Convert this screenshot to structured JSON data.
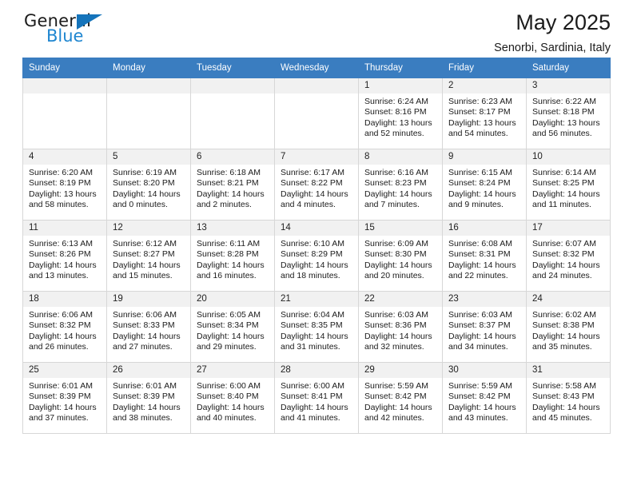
{
  "brand": {
    "name_top": "General",
    "name_bottom": "Blue",
    "flag_icon": "blue-triangle-flag",
    "color_dark": "#1b1b1b",
    "color_blue": "#1f86d0"
  },
  "header": {
    "title": "May 2025",
    "subtitle": "Senorbi, Sardinia, Italy"
  },
  "theme": {
    "header_row_bg": "#3a7dc0",
    "header_row_text": "#ffffff",
    "daynum_bg": "#f1f1f1",
    "cell_border": "#d7d7d7"
  },
  "weekdays": [
    "Sunday",
    "Monday",
    "Tuesday",
    "Wednesday",
    "Thursday",
    "Friday",
    "Saturday"
  ],
  "labels": {
    "sunrise": "Sunrise:",
    "sunset": "Sunset:",
    "daylight": "Daylight:"
  },
  "weeks": [
    [
      {
        "day": ""
      },
      {
        "day": ""
      },
      {
        "day": ""
      },
      {
        "day": ""
      },
      {
        "day": "1",
        "sunrise": "Sunrise: 6:24 AM",
        "sunset": "Sunset: 8:16 PM",
        "daylight_1": "Daylight: 13 hours",
        "daylight_2": "and 52 minutes."
      },
      {
        "day": "2",
        "sunrise": "Sunrise: 6:23 AM",
        "sunset": "Sunset: 8:17 PM",
        "daylight_1": "Daylight: 13 hours",
        "daylight_2": "and 54 minutes."
      },
      {
        "day": "3",
        "sunrise": "Sunrise: 6:22 AM",
        "sunset": "Sunset: 8:18 PM",
        "daylight_1": "Daylight: 13 hours",
        "daylight_2": "and 56 minutes."
      }
    ],
    [
      {
        "day": "4",
        "sunrise": "Sunrise: 6:20 AM",
        "sunset": "Sunset: 8:19 PM",
        "daylight_1": "Daylight: 13 hours",
        "daylight_2": "and 58 minutes."
      },
      {
        "day": "5",
        "sunrise": "Sunrise: 6:19 AM",
        "sunset": "Sunset: 8:20 PM",
        "daylight_1": "Daylight: 14 hours",
        "daylight_2": "and 0 minutes."
      },
      {
        "day": "6",
        "sunrise": "Sunrise: 6:18 AM",
        "sunset": "Sunset: 8:21 PM",
        "daylight_1": "Daylight: 14 hours",
        "daylight_2": "and 2 minutes."
      },
      {
        "day": "7",
        "sunrise": "Sunrise: 6:17 AM",
        "sunset": "Sunset: 8:22 PM",
        "daylight_1": "Daylight: 14 hours",
        "daylight_2": "and 4 minutes."
      },
      {
        "day": "8",
        "sunrise": "Sunrise: 6:16 AM",
        "sunset": "Sunset: 8:23 PM",
        "daylight_1": "Daylight: 14 hours",
        "daylight_2": "and 7 minutes."
      },
      {
        "day": "9",
        "sunrise": "Sunrise: 6:15 AM",
        "sunset": "Sunset: 8:24 PM",
        "daylight_1": "Daylight: 14 hours",
        "daylight_2": "and 9 minutes."
      },
      {
        "day": "10",
        "sunrise": "Sunrise: 6:14 AM",
        "sunset": "Sunset: 8:25 PM",
        "daylight_1": "Daylight: 14 hours",
        "daylight_2": "and 11 minutes."
      }
    ],
    [
      {
        "day": "11",
        "sunrise": "Sunrise: 6:13 AM",
        "sunset": "Sunset: 8:26 PM",
        "daylight_1": "Daylight: 14 hours",
        "daylight_2": "and 13 minutes."
      },
      {
        "day": "12",
        "sunrise": "Sunrise: 6:12 AM",
        "sunset": "Sunset: 8:27 PM",
        "daylight_1": "Daylight: 14 hours",
        "daylight_2": "and 15 minutes."
      },
      {
        "day": "13",
        "sunrise": "Sunrise: 6:11 AM",
        "sunset": "Sunset: 8:28 PM",
        "daylight_1": "Daylight: 14 hours",
        "daylight_2": "and 16 minutes."
      },
      {
        "day": "14",
        "sunrise": "Sunrise: 6:10 AM",
        "sunset": "Sunset: 8:29 PM",
        "daylight_1": "Daylight: 14 hours",
        "daylight_2": "and 18 minutes."
      },
      {
        "day": "15",
        "sunrise": "Sunrise: 6:09 AM",
        "sunset": "Sunset: 8:30 PM",
        "daylight_1": "Daylight: 14 hours",
        "daylight_2": "and 20 minutes."
      },
      {
        "day": "16",
        "sunrise": "Sunrise: 6:08 AM",
        "sunset": "Sunset: 8:31 PM",
        "daylight_1": "Daylight: 14 hours",
        "daylight_2": "and 22 minutes."
      },
      {
        "day": "17",
        "sunrise": "Sunrise: 6:07 AM",
        "sunset": "Sunset: 8:32 PM",
        "daylight_1": "Daylight: 14 hours",
        "daylight_2": "and 24 minutes."
      }
    ],
    [
      {
        "day": "18",
        "sunrise": "Sunrise: 6:06 AM",
        "sunset": "Sunset: 8:32 PM",
        "daylight_1": "Daylight: 14 hours",
        "daylight_2": "and 26 minutes."
      },
      {
        "day": "19",
        "sunrise": "Sunrise: 6:06 AM",
        "sunset": "Sunset: 8:33 PM",
        "daylight_1": "Daylight: 14 hours",
        "daylight_2": "and 27 minutes."
      },
      {
        "day": "20",
        "sunrise": "Sunrise: 6:05 AM",
        "sunset": "Sunset: 8:34 PM",
        "daylight_1": "Daylight: 14 hours",
        "daylight_2": "and 29 minutes."
      },
      {
        "day": "21",
        "sunrise": "Sunrise: 6:04 AM",
        "sunset": "Sunset: 8:35 PM",
        "daylight_1": "Daylight: 14 hours",
        "daylight_2": "and 31 minutes."
      },
      {
        "day": "22",
        "sunrise": "Sunrise: 6:03 AM",
        "sunset": "Sunset: 8:36 PM",
        "daylight_1": "Daylight: 14 hours",
        "daylight_2": "and 32 minutes."
      },
      {
        "day": "23",
        "sunrise": "Sunrise: 6:03 AM",
        "sunset": "Sunset: 8:37 PM",
        "daylight_1": "Daylight: 14 hours",
        "daylight_2": "and 34 minutes."
      },
      {
        "day": "24",
        "sunrise": "Sunrise: 6:02 AM",
        "sunset": "Sunset: 8:38 PM",
        "daylight_1": "Daylight: 14 hours",
        "daylight_2": "and 35 minutes."
      }
    ],
    [
      {
        "day": "25",
        "sunrise": "Sunrise: 6:01 AM",
        "sunset": "Sunset: 8:39 PM",
        "daylight_1": "Daylight: 14 hours",
        "daylight_2": "and 37 minutes."
      },
      {
        "day": "26",
        "sunrise": "Sunrise: 6:01 AM",
        "sunset": "Sunset: 8:39 PM",
        "daylight_1": "Daylight: 14 hours",
        "daylight_2": "and 38 minutes."
      },
      {
        "day": "27",
        "sunrise": "Sunrise: 6:00 AM",
        "sunset": "Sunset: 8:40 PM",
        "daylight_1": "Daylight: 14 hours",
        "daylight_2": "and 40 minutes."
      },
      {
        "day": "28",
        "sunrise": "Sunrise: 6:00 AM",
        "sunset": "Sunset: 8:41 PM",
        "daylight_1": "Daylight: 14 hours",
        "daylight_2": "and 41 minutes."
      },
      {
        "day": "29",
        "sunrise": "Sunrise: 5:59 AM",
        "sunset": "Sunset: 8:42 PM",
        "daylight_1": "Daylight: 14 hours",
        "daylight_2": "and 42 minutes."
      },
      {
        "day": "30",
        "sunrise": "Sunrise: 5:59 AM",
        "sunset": "Sunset: 8:42 PM",
        "daylight_1": "Daylight: 14 hours",
        "daylight_2": "and 43 minutes."
      },
      {
        "day": "31",
        "sunrise": "Sunrise: 5:58 AM",
        "sunset": "Sunset: 8:43 PM",
        "daylight_1": "Daylight: 14 hours",
        "daylight_2": "and 45 minutes."
      }
    ]
  ]
}
